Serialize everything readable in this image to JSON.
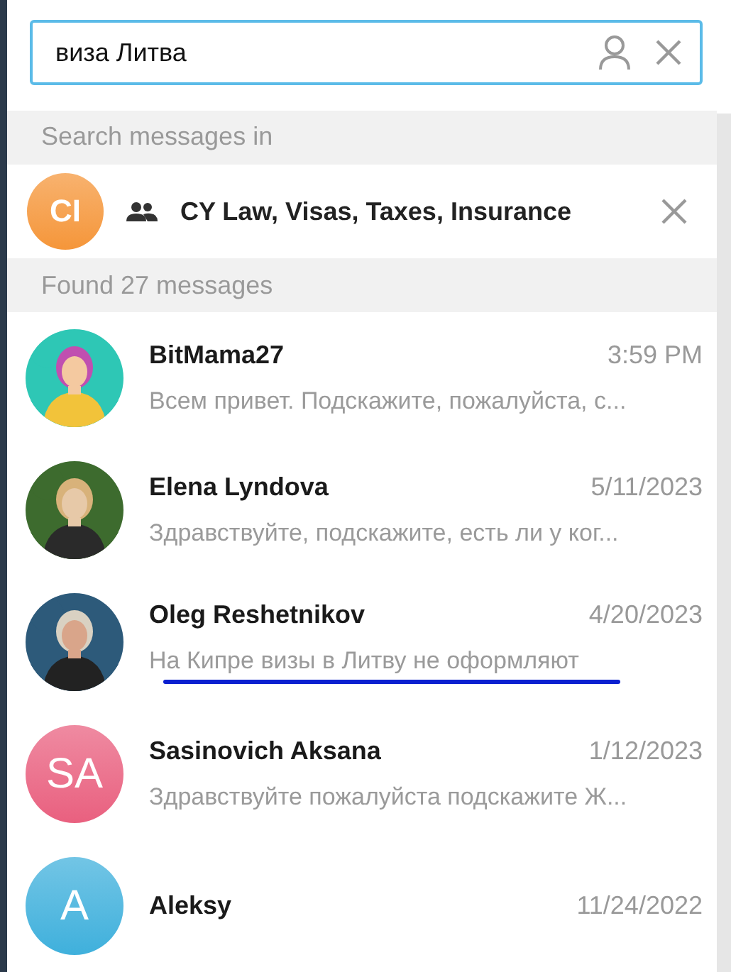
{
  "search": {
    "value": "виза Литва"
  },
  "search_in": {
    "header": "Search messages in",
    "chat": {
      "initials": "CI",
      "color": "#f5963a",
      "title": "CY Law, Visas, Taxes, Insurance"
    }
  },
  "results": {
    "header": "Found 27 messages",
    "messages": [
      {
        "kind": "picture",
        "name": "BitMama27",
        "time": "3:59 PM",
        "preview": "Всем привет. Подскажите, пожалуйста, с...",
        "underlined": false
      },
      {
        "kind": "picture",
        "name": "Elena Lyndova",
        "time": "5/11/2023",
        "preview": "Здравствуйте, подскажите, есть ли у ког...",
        "underlined": false
      },
      {
        "kind": "picture",
        "name": "Oleg Reshetnikov",
        "time": "4/20/2023",
        "preview": "На Кипре визы в Литву не оформляют",
        "underlined": true
      },
      {
        "kind": "initials",
        "initials": "SA",
        "color": "#e9607f",
        "name": "Sasinovich Aksana",
        "time": "1/12/2023",
        "preview": "Здравствуйте пожалуйста подскажите Ж...",
        "underlined": false
      },
      {
        "kind": "initials",
        "initials": "A",
        "color": "#3fb0dc",
        "name": "Aleksy",
        "time": "11/24/2022",
        "underlined": false
      }
    ]
  }
}
